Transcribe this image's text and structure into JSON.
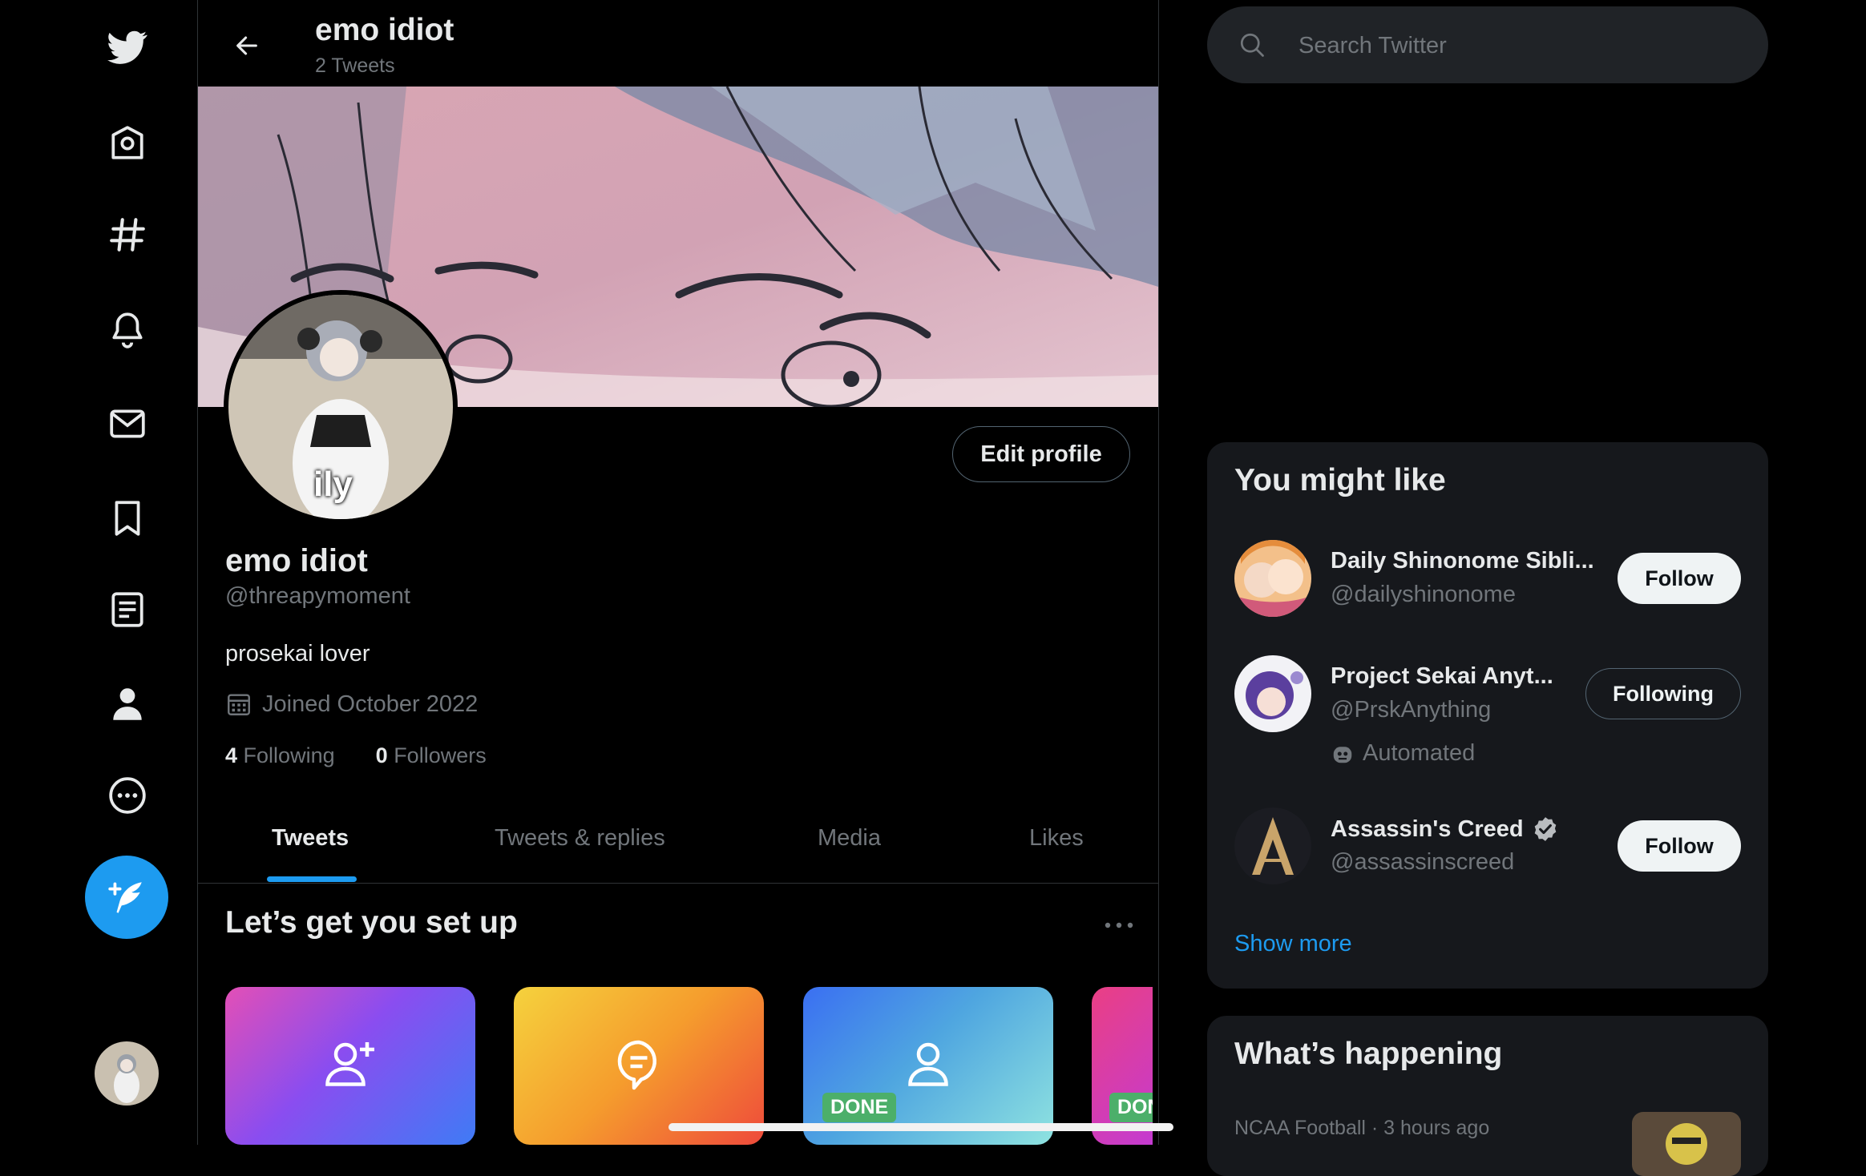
{
  "profile": {
    "header_name": "emo idiot",
    "tweet_count": "2 Tweets",
    "display_name": "emo idiot",
    "handle": "@threapymoment",
    "bio": "prosekai lover",
    "joined": "Joined October 2022",
    "following_count": "4",
    "following_label": "Following",
    "followers_count": "0",
    "followers_label": "Followers",
    "edit_profile_label": "Edit profile",
    "avatar_caption": "ily"
  },
  "tabs": [
    "Tweets",
    "Tweets & replies",
    "Media",
    "Likes"
  ],
  "active_tab": "Tweets",
  "setup": {
    "title": "Let’s get you set up",
    "cards": [
      {
        "icon": "add-user-icon",
        "badge": ""
      },
      {
        "icon": "chat-bubble-icon",
        "badge": ""
      },
      {
        "icon": "user-icon",
        "badge": "DONE"
      },
      {
        "icon": "",
        "badge": "DONE"
      }
    ]
  },
  "nav": [
    "twitter-logo-icon",
    "home-icon",
    "explore-icon",
    "notifications-icon",
    "messages-icon",
    "bookmarks-icon",
    "lists-icon",
    "profile-icon",
    "more-icon"
  ],
  "search": {
    "placeholder": "Search Twitter"
  },
  "who_to_follow": {
    "title": "You might like",
    "accounts": [
      {
        "name": "Daily Shinonome Sibli...",
        "handle": "@dailyshinonome",
        "button": "Follow"
      },
      {
        "name": "Project Sekai Anyt...",
        "handle": "@PrskAnything",
        "button": "Following",
        "tag": "Automated"
      },
      {
        "name": "Assassin's Creed",
        "handle": "@assassinscreed",
        "button": "Follow",
        "verified": true
      }
    ],
    "show_more": "Show more"
  },
  "happening": {
    "title": "What’s happening",
    "first_trend_meta": "NCAA Football · 3 hours ago"
  },
  "colors": {
    "accent": "#1d9bf0",
    "bg": "#000000",
    "panel": "#16181c",
    "muted": "#71767b"
  }
}
